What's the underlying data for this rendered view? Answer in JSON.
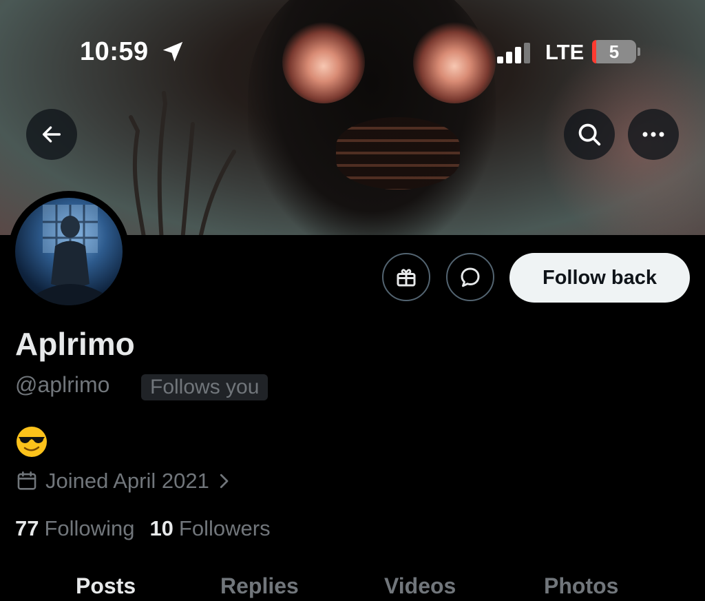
{
  "status_bar": {
    "time": "10:59",
    "network": "LTE",
    "battery": "5"
  },
  "header": {
    "icons": [
      "back-arrow-icon",
      "search-icon",
      "more-icon"
    ]
  },
  "profile": {
    "display_name": "Aplrimo",
    "handle": "@aplrimo",
    "follows_badge": "Follows you",
    "bio": "😎",
    "joined": "Joined April 2021",
    "following_count": "77",
    "following_label": "Following",
    "followers_count": "10",
    "followers_label": "Followers"
  },
  "actions": {
    "follow_label": "Follow back",
    "icons": [
      "gift-icon",
      "message-icon"
    ]
  },
  "tabs": [
    {
      "label": "Posts"
    },
    {
      "label": "Replies"
    },
    {
      "label": "Videos"
    },
    {
      "label": "Photos"
    }
  ],
  "colors": {
    "background": "#000000",
    "primary_text": "#e7e9ea",
    "secondary_text": "#71767b",
    "follow_button_bg": "#eff3f4",
    "battery_low": "#ff3b30"
  }
}
